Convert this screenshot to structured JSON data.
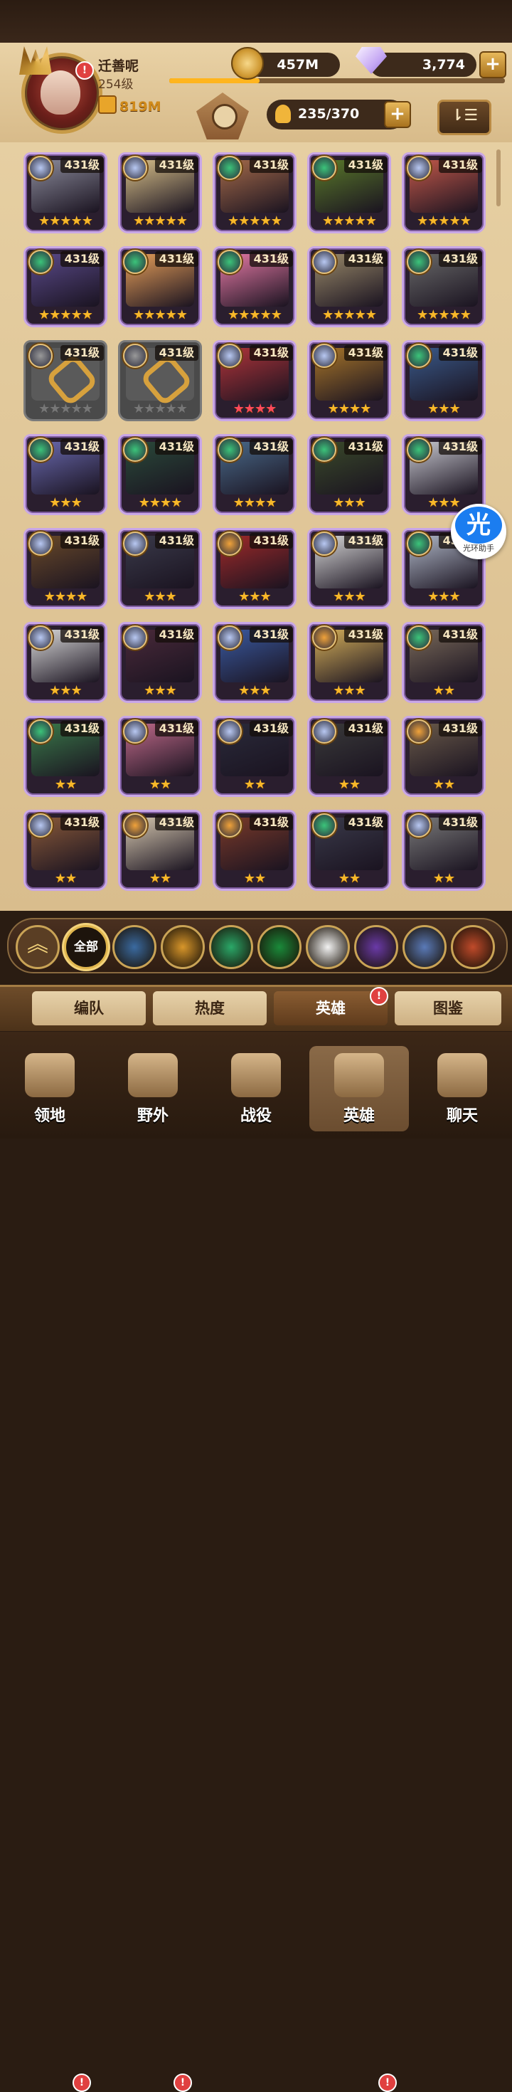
{
  "player": {
    "name": "迁善呢",
    "level": "254级",
    "power": "819M",
    "notification": "!",
    "xp_fraction": 0.27
  },
  "currencies": {
    "gold": "457M",
    "diamonds": "3,774",
    "plus": "+"
  },
  "roster": {
    "capacity": "235/370",
    "plus": "+",
    "sort_icon": "⇂☰"
  },
  "heroes": [
    {
      "level": "431级",
      "stars": "★★★★★",
      "color": "#8c8c9c",
      "faction": "#b8c8f2"
    },
    {
      "level": "431级",
      "stars": "★★★★★",
      "color": "#d8c08a",
      "faction": "#b8c8f2"
    },
    {
      "level": "431级",
      "stars": "★★★★★",
      "color": "#a46a4a",
      "faction": "#3bc47a"
    },
    {
      "level": "431级",
      "stars": "★★★★★",
      "color": "#5a7a2a",
      "faction": "#3bc47a"
    },
    {
      "level": "431级",
      "stars": "★★★★★",
      "color": "#c2584a",
      "faction": "#b8c8f2"
    },
    {
      "level": "431级",
      "stars": "★★★★★",
      "color": "#5a4a8a",
      "faction": "#3bc47a"
    },
    {
      "level": "431级",
      "stars": "★★★★★",
      "color": "#e8a05a",
      "faction": "#3bc47a"
    },
    {
      "level": "431级",
      "stars": "★★★★★",
      "color": "#e67aa6",
      "faction": "#3bc47a"
    },
    {
      "level": "431级",
      "stars": "★★★★★",
      "color": "#9a8a6a",
      "faction": "#b8c8f2"
    },
    {
      "level": "431级",
      "stars": "★★★★★",
      "color": "#6a6a6a",
      "faction": "#3bc47a"
    },
    {
      "level": "431级",
      "stars": "★★★★★",
      "color": "#555",
      "faction": "#999",
      "locked": true
    },
    {
      "level": "431级",
      "stars": "★★★★★",
      "color": "#555",
      "faction": "#999",
      "locked": true
    },
    {
      "level": "431级",
      "stars": "★★★★",
      "color": "#b0343a",
      "faction": "#b8c8f2",
      "red": true
    },
    {
      "level": "431级",
      "stars": "★★★★",
      "color": "#a8762a",
      "faction": "#b8c8f2"
    },
    {
      "level": "431级",
      "stars": "★★★",
      "color": "#3a5a8a",
      "faction": "#3bc47a"
    },
    {
      "level": "431级",
      "stars": "★★★",
      "color": "#6a6ab0",
      "faction": "#3bc47a"
    },
    {
      "level": "431级",
      "stars": "★★★★",
      "color": "#2a4a3a",
      "faction": "#3bc47a"
    },
    {
      "level": "431级",
      "stars": "★★★★",
      "color": "#4a6a8a",
      "faction": "#3bc47a"
    },
    {
      "level": "431级",
      "stars": "★★★",
      "color": "#3a4a2a",
      "faction": "#3bc47a"
    },
    {
      "level": "431级",
      "stars": "★★★",
      "color": "#c8c8d0",
      "faction": "#3bc47a"
    },
    {
      "level": "431级",
      "stars": "★★★★",
      "color": "#6a4a2a",
      "faction": "#b8c8f2"
    },
    {
      "level": "431级",
      "stars": "★★★",
      "color": "#3a3a4a",
      "faction": "#b8c8f2"
    },
    {
      "level": "431级",
      "stars": "★★★",
      "color": "#a02a2a",
      "faction": "#f0a23a"
    },
    {
      "level": "431级",
      "stars": "★★★",
      "color": "#d8d8d8",
      "faction": "#b8c8f2"
    },
    {
      "level": "431级",
      "stars": "★★★",
      "color": "#b0b8c8",
      "faction": "#3bc47a"
    },
    {
      "level": "431级",
      "stars": "★★★",
      "color": "#dadada",
      "faction": "#b8c8f2"
    },
    {
      "level": "431级",
      "stars": "★★★",
      "color": "#4a2a3a",
      "faction": "#b8c8f2"
    },
    {
      "level": "431级",
      "stars": "★★★",
      "color": "#3a5aa0",
      "faction": "#b8c8f2"
    },
    {
      "level": "431级",
      "stars": "★★★",
      "color": "#d6b05a",
      "faction": "#f0a23a"
    },
    {
      "level": "431级",
      "stars": "★★",
      "color": "#7a6a5a",
      "faction": "#3bc47a"
    },
    {
      "level": "431级",
      "stars": "★★",
      "color": "#3a7a4a",
      "faction": "#3bc47a"
    },
    {
      "level": "431级",
      "stars": "★★",
      "color": "#c06a8a",
      "faction": "#b8c8f2"
    },
    {
      "level": "431级",
      "stars": "★★",
      "color": "#2a2a3a",
      "faction": "#b8c8f2"
    },
    {
      "level": "431级",
      "stars": "★★",
      "color": "#3a3a3a",
      "faction": "#b8c8f2"
    },
    {
      "level": "431级",
      "stars": "★★",
      "color": "#6a5a4a",
      "faction": "#f0a23a"
    },
    {
      "level": "431级",
      "stars": "★★",
      "color": "#8a5a3a",
      "faction": "#b8c8f2"
    },
    {
      "level": "431级",
      "stars": "★★",
      "color": "#d6c8b0",
      "faction": "#f0a23a"
    },
    {
      "level": "431级",
      "stars": "★★",
      "color": "#7a3a2a",
      "faction": "#f0a23a"
    },
    {
      "level": "431级",
      "stars": "★★",
      "color": "#3a3a4a",
      "faction": "#3bc47a"
    },
    {
      "level": "431级",
      "stars": "★★",
      "color": "#7a7a7a",
      "faction": "#b8c8f2"
    }
  ],
  "floating_badge": {
    "glyph": "光",
    "label": "光环助手"
  },
  "filters": [
    {
      "name": "collapse",
      "label": "︽"
    },
    {
      "name": "all",
      "label": "全部"
    },
    {
      "name": "lightbearer",
      "color": "#3a6aa0"
    },
    {
      "name": "mauler",
      "color": "#d8962a"
    },
    {
      "name": "wilder",
      "color": "#2aa868"
    },
    {
      "name": "graveborn",
      "color": "#1a8a3a"
    },
    {
      "name": "celestial",
      "color": "#f2f2f2"
    },
    {
      "name": "hypogean",
      "color": "#6a3aa8"
    },
    {
      "name": "dimensional",
      "color": "#5a7ab8"
    },
    {
      "name": "fire",
      "color": "#c04a2a"
    }
  ],
  "tabs": {
    "formation": "编队",
    "popularity": "热度",
    "heroes": "英雄",
    "codex": "图鉴"
  },
  "nav": {
    "territory": "领地",
    "wilderness": "野外",
    "campaign": "战役",
    "heroes": "英雄",
    "chat": "聊天"
  }
}
